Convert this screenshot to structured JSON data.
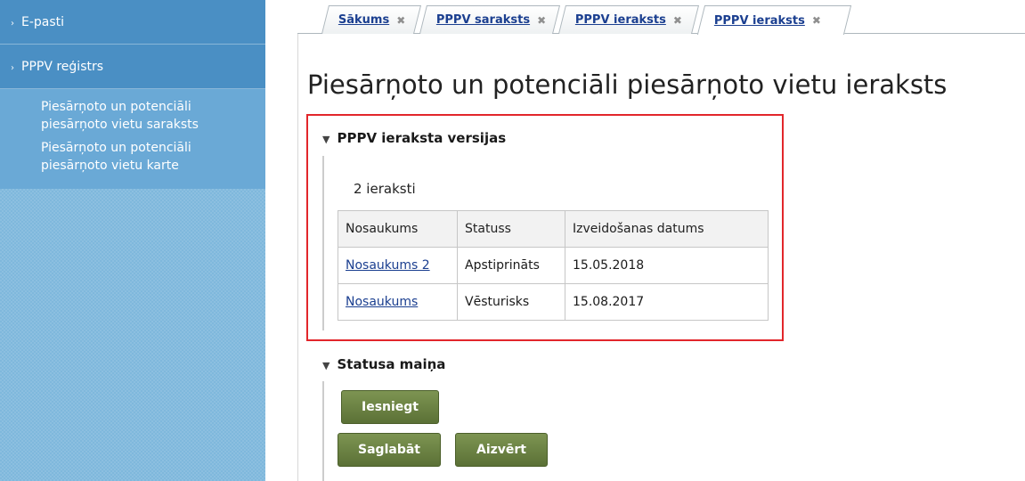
{
  "sidebar": {
    "items": [
      {
        "label": "E-pasti"
      },
      {
        "label": "PPPV reģistrs"
      }
    ],
    "sub_links": [
      {
        "line1": "Piesārņoto un potenciāli",
        "line2": "piesārņoto vietu saraksts"
      },
      {
        "line1": "Piesārņoto un potenciāli",
        "line2": "piesārņoto vietu karte"
      }
    ]
  },
  "tabs": [
    {
      "label": "Sākums"
    },
    {
      "label": "PPPV saraksts"
    },
    {
      "label": "PPPV ieraksts"
    },
    {
      "label": "PPPV ieraksts"
    }
  ],
  "page": {
    "title": "Piesārņoto un potenciāli piesārņoto vietu ieraksts"
  },
  "versions": {
    "heading": "PPPV ieraksta versijas",
    "count": "2 ieraksti",
    "columns": [
      "Nosaukums",
      "Statuss",
      "Izveidošanas datums"
    ],
    "rows": [
      {
        "name": "Nosaukums 2",
        "status": "Apstiprināts",
        "date": "15.05.2018"
      },
      {
        "name": "Nosaukums",
        "status": "Vēsturisks",
        "date": "15.08.2017"
      }
    ]
  },
  "status_change": {
    "heading": "Statusa maiņa",
    "submit_label": "Iesniegt"
  },
  "actions": {
    "save_label": "Saglabāt",
    "close_label": "Aizvērt"
  },
  "icons": {
    "chevron": "›",
    "close": "✖",
    "triangle": "▼"
  },
  "colors": {
    "sidebar_bg": "#7fb8dc",
    "sidebar_top": "#4a8fc4",
    "link": "#1b3f90",
    "highlight_box": "#e2262b",
    "button": "#6a8141"
  }
}
